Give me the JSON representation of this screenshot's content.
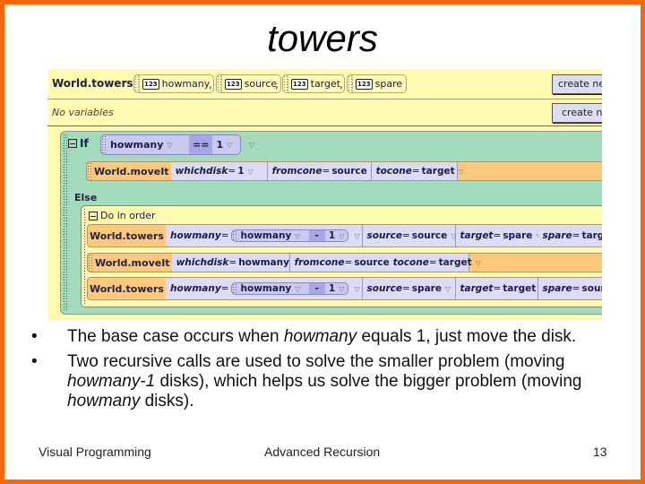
{
  "slide": {
    "title": "towers",
    "footer": {
      "left": "Visual Programming",
      "center": "Advanced Recursion",
      "page_number": "13"
    },
    "border_color": "#ff6600"
  },
  "editor": {
    "method_name": "World.towers",
    "parameters": [
      {
        "icon": "123",
        "name": "howmany"
      },
      {
        "icon": "123",
        "name": "source"
      },
      {
        "icon": "123",
        "name": "target"
      },
      {
        "icon": "123",
        "name": "spare"
      }
    ],
    "separator": ",",
    "no_variables": "No variables",
    "create_new_parameter": "create new",
    "create_new_variable": "create new",
    "if_label": "If",
    "condition": {
      "left": "howmany",
      "operator": "==",
      "right": "1"
    },
    "if_statement": {
      "callee": "World.moveIt",
      "args": [
        {
          "name": "whichdisk",
          "eq": " = ",
          "value": "1"
        },
        {
          "name": "fromcone",
          "eq": " = ",
          "value": "source"
        },
        {
          "name": "tocone",
          "eq": " = ",
          "value": "target"
        }
      ]
    },
    "else_label": "Else",
    "do_in_order_label": "Do in order",
    "else_statements": [
      {
        "callee": "World.towers",
        "howmany_expr": {
          "param": "howmany",
          "eq": " = ",
          "left": "howmany",
          "operator": "-",
          "right": "1"
        },
        "args": [
          {
            "name": "source",
            "eq": " = ",
            "value": "source"
          },
          {
            "name": "target",
            "eq": " = ",
            "value": "spare"
          },
          {
            "name": "spare",
            "eq": " = ",
            "value": "target"
          }
        ]
      },
      {
        "callee": "World.moveIt",
        "args": [
          {
            "name": "whichdisk",
            "eq": " = ",
            "value": "howmany"
          },
          {
            "name": "fromcone",
            "eq": " = ",
            "value": "source"
          },
          {
            "name": "tocone",
            "eq": " = ",
            "value": "target"
          }
        ]
      },
      {
        "callee": "World.towers",
        "howmany_expr": {
          "param": "howmany",
          "eq": " = ",
          "left": "howmany",
          "operator": "-",
          "right": "1"
        },
        "args": [
          {
            "name": "source",
            "eq": " = ",
            "value": "spare"
          },
          {
            "name": "target",
            "eq": " = ",
            "value": "target"
          },
          {
            "name": "spare",
            "eq": " = ",
            "value": "source"
          }
        ]
      }
    ],
    "dropdown_glyph": "▽"
  },
  "bullets": [
    {
      "bullet": "•",
      "parts": [
        "The base case occurs when ",
        "howmany",
        " equals 1, just move the disk."
      ]
    },
    {
      "bullet": "•",
      "parts": [
        "Two recursive calls are used to solve the smaller problem (moving ",
        "howmany-1",
        " disks), which helps us solve the bigger problem (moving ",
        "howmany",
        " disks)."
      ]
    }
  ]
}
